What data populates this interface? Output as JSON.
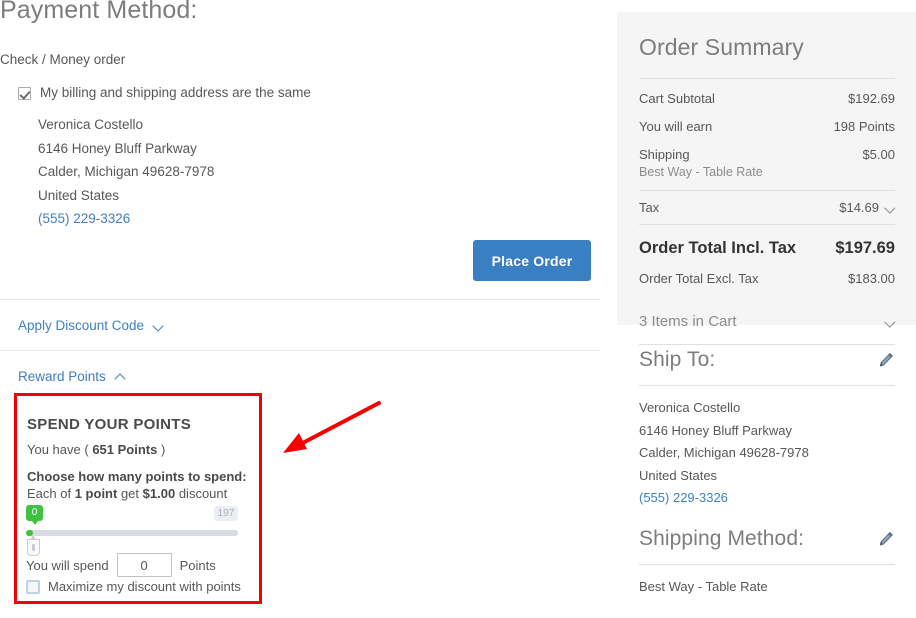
{
  "colors": {
    "accent_blue": "#3a7fc1",
    "link_blue": "#3f7fbf",
    "highlight_red": "#f70000",
    "slider_green": "#3fc23f",
    "panel_bg": "#f5f5f5",
    "text": "#575757"
  },
  "checkout": {
    "page_title": "Payment Method:",
    "payment_method_name": "Check / Money order",
    "billing_same_label": "My billing and shipping address are the same",
    "billing_same_checked": true,
    "billing_address": {
      "name": "Veronica Costello",
      "street": "6146 Honey Bluff Parkway",
      "city_state_zip": "Calder, Michigan 49628-7978",
      "country": "United States",
      "phone": "(555) 229-3326"
    },
    "place_order_label": "Place Order",
    "discount_toggle_label": "Apply Discount Code",
    "reward_toggle_label": "Reward Points"
  },
  "reward_points": {
    "section_title": "SPEND YOUR POINTS",
    "you_have_prefix": "You have (",
    "you_have_value": "651 Points",
    "you_have_suffix": ")",
    "choose_label": "Choose how many points to spend:",
    "rate_prefix": "Each of",
    "rate_points": "1 point",
    "rate_mid": "get",
    "rate_amount": "$1.00",
    "rate_suffix": "discount",
    "slider_min_badge": "0",
    "slider_max_badge": "197",
    "slider_value": 0,
    "slider_min": 0,
    "slider_max": 197,
    "spend_prefix": "You will spend",
    "spend_value": "0",
    "spend_suffix": "Points",
    "maximize_label": "Maximize my discount with points",
    "maximize_checked": false
  },
  "order_summary": {
    "heading": "Order Summary",
    "rows": [
      {
        "label": "Cart Subtotal",
        "value": "$192.69"
      },
      {
        "label": "You will earn",
        "value": "198 Points"
      }
    ],
    "shipping": {
      "label": "Shipping",
      "value": "$5.00",
      "method_note": "Best Way - Table Rate"
    },
    "tax": {
      "label": "Tax",
      "value": "$14.69"
    },
    "total_incl": {
      "label": "Order Total Incl. Tax",
      "value": "$197.69"
    },
    "total_excl": {
      "label": "Order Total Excl. Tax",
      "value": "$183.00"
    },
    "items_in_cart": "3 Items in Cart"
  },
  "ship_to": {
    "title": "Ship To:",
    "name": "Veronica Costello",
    "street": "6146 Honey Bluff Parkway",
    "city_state_zip": "Calder, Michigan 49628-7978",
    "country": "United States",
    "phone": "(555) 229-3326"
  },
  "shipping_method": {
    "title": "Shipping Method:",
    "value": "Best Way - Table Rate"
  }
}
